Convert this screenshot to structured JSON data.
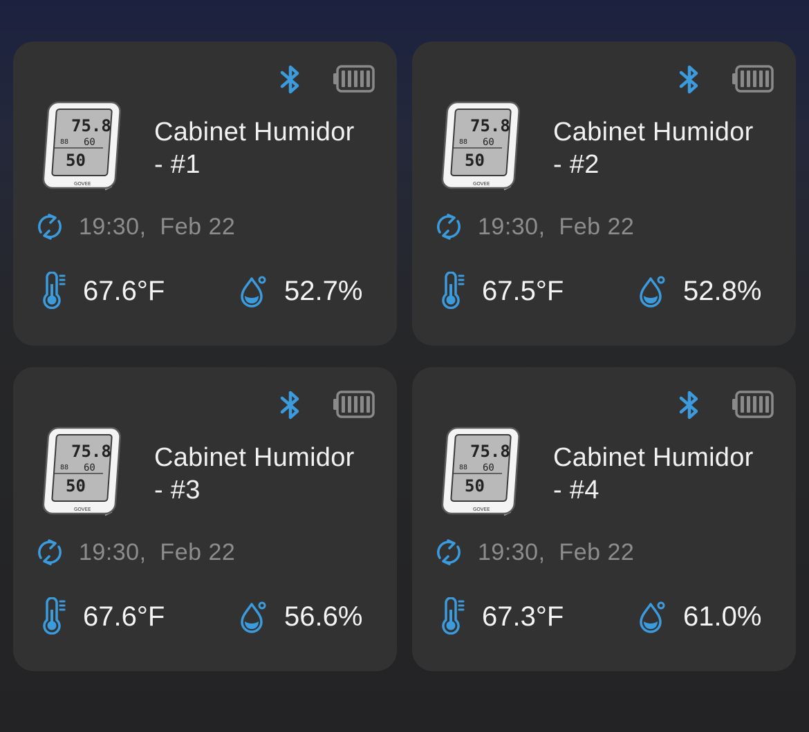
{
  "colors": {
    "accent": "#3b9bdc",
    "card": "#323232",
    "muted": "#8d8d8d"
  },
  "icons": {
    "bluetooth": "bluetooth-icon",
    "battery": "battery-full-icon",
    "sync": "sync-icon",
    "temperature": "thermometer-icon",
    "humidity": "humidity-drop-icon"
  },
  "devices": [
    {
      "name_line1": "Cabinet Humidor",
      "name_line2": "- #1",
      "time": "19:30,  Feb 22",
      "temperature": "67.6°F",
      "humidity": "52.7%"
    },
    {
      "name_line1": "Cabinet Humidor",
      "name_line2": "- #2",
      "time": "19:30,  Feb 22",
      "temperature": "67.5°F",
      "humidity": "52.8%"
    },
    {
      "name_line1": "Cabinet Humidor",
      "name_line2": "- #3",
      "time": "19:30,  Feb 22",
      "temperature": "67.6°F",
      "humidity": "56.6%"
    },
    {
      "name_line1": "Cabinet Humidor",
      "name_line2": "- #4",
      "time": "19:30,  Feb 22",
      "temperature": "67.3°F",
      "humidity": "61.0%"
    }
  ]
}
